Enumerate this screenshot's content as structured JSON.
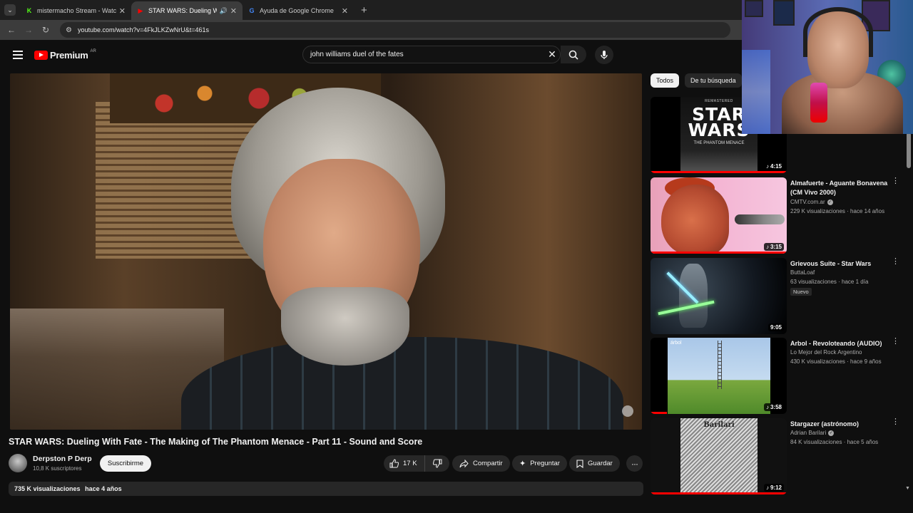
{
  "browser": {
    "tabs": [
      {
        "favicon": "K",
        "favicon_color": "#53fc18",
        "title": "mistermacho Stream - Watch Li",
        "active": false
      },
      {
        "favicon": "▶",
        "favicon_color": "#ff0000",
        "title": "STAR WARS: Dueling With F",
        "active": true,
        "audio": true
      },
      {
        "favicon": "G",
        "favicon_color": "#4285f4",
        "title": "Ayuda de Google Chrome",
        "active": false
      }
    ],
    "url": "youtube.com/watch?v=4FkJLKZwNrU&t=461s"
  },
  "header": {
    "logo_text": "Premium",
    "country": "AR",
    "search_query": "john williams duel of the fates"
  },
  "video": {
    "title": "STAR WARS: Dueling With Fate - The Making of The Phantom Menace - Part 11 - Sound and Score",
    "channel": "Derpston P Derp",
    "subscribers": "10,8 K suscriptores",
    "subscribe_label": "Suscribirme",
    "likes": "17 K",
    "share_label": "Compartir",
    "ask_label": "Preguntar",
    "save_label": "Guardar",
    "views": "735 K visualizaciones",
    "age": "hace 4 años"
  },
  "sidebar": {
    "chips": [
      "Todos",
      "De tu búsqueda"
    ],
    "items": [
      {
        "title": "",
        "channel": "",
        "meta": "",
        "duration": "4:15",
        "progress": 1.0,
        "thumb_remaster": "REMASTERED",
        "thumb_logo": "STAR\nWARS",
        "thumb_sub": "THE PHANTOM MENACE"
      },
      {
        "title": "Almafuerte - Aguante Bonavena (CM Vivo 2000)",
        "channel": "CMTV.com.ar",
        "verified": true,
        "meta": "229 K visualizaciones · hace 14 años",
        "duration": "3:15",
        "progress": 1.0
      },
      {
        "title": "Grievous Suite - Star Wars",
        "channel": "ButtaLoaf",
        "verified": false,
        "meta": "63 visualizaciones · hace 1 día",
        "badge": "Nuevo",
        "duration": "9:05",
        "progress": 0
      },
      {
        "title": "Arbol - Revoloteando (AUDIO)",
        "channel": "Lo Mejor del Rock Argentino",
        "verified": false,
        "meta": "430 K visualizaciones · hace 9 años",
        "duration": "3:58",
        "progress": 0.12,
        "thumb_label": "árbol"
      },
      {
        "title": "Stargazer (astrónomo)",
        "channel": "Adrian Barilari",
        "verified": true,
        "meta": "84 K visualizaciones · hace 5 años",
        "duration": "9:12",
        "progress": 1.0,
        "thumb_label": "Barilari"
      }
    ]
  }
}
